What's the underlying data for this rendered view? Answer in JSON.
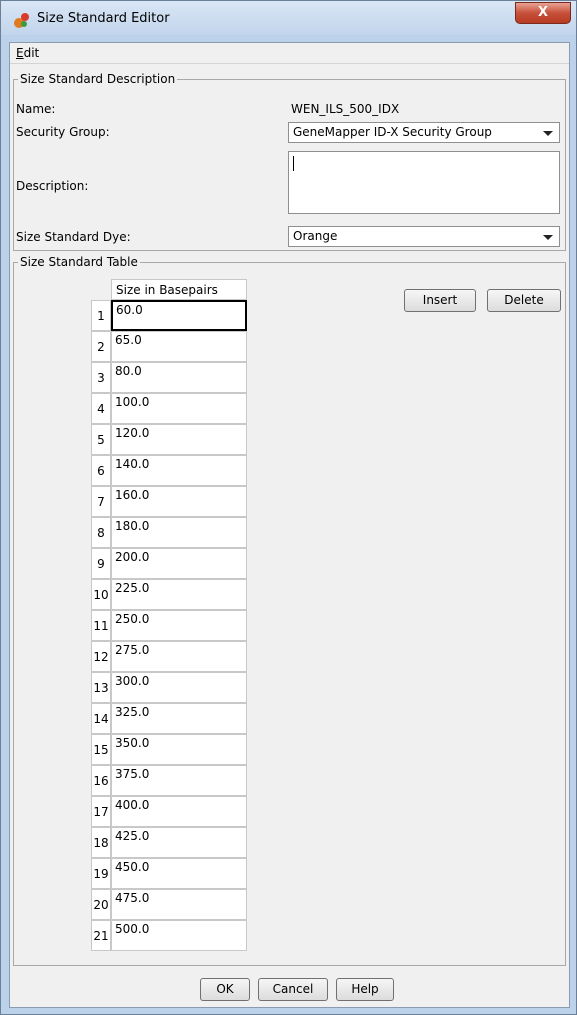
{
  "window": {
    "title": "Size Standard Editor",
    "close_glyph": "X"
  },
  "menu": {
    "edit_label": "Edit"
  },
  "description_group": {
    "title": "Size Standard Description",
    "name_label": "Name:",
    "name_value": "WEN_ILS_500_IDX",
    "security_label": "Security Group:",
    "security_value": "GeneMapper ID-X Security Group",
    "description_label": "Description:",
    "description_value": "",
    "dye_label": "Size Standard Dye:",
    "dye_value": "Orange"
  },
  "table_group": {
    "title": "Size Standard Table",
    "column_header": "Size in Basepairs",
    "selected_row": 1,
    "rows": [
      {
        "index": "1",
        "size": "60.0"
      },
      {
        "index": "2",
        "size": "65.0"
      },
      {
        "index": "3",
        "size": "80.0"
      },
      {
        "index": "4",
        "size": "100.0"
      },
      {
        "index": "5",
        "size": "120.0"
      },
      {
        "index": "6",
        "size": "140.0"
      },
      {
        "index": "7",
        "size": "160.0"
      },
      {
        "index": "8",
        "size": "180.0"
      },
      {
        "index": "9",
        "size": "200.0"
      },
      {
        "index": "10",
        "size": "225.0"
      },
      {
        "index": "11",
        "size": "250.0"
      },
      {
        "index": "12",
        "size": "275.0"
      },
      {
        "index": "13",
        "size": "300.0"
      },
      {
        "index": "14",
        "size": "325.0"
      },
      {
        "index": "15",
        "size": "350.0"
      },
      {
        "index": "16",
        "size": "375.0"
      },
      {
        "index": "17",
        "size": "400.0"
      },
      {
        "index": "18",
        "size": "425.0"
      },
      {
        "index": "19",
        "size": "450.0"
      },
      {
        "index": "20",
        "size": "475.0"
      },
      {
        "index": "21",
        "size": "500.0"
      }
    ],
    "insert_label": "Insert",
    "delete_label": "Delete"
  },
  "footer": {
    "ok_label": "OK",
    "cancel_label": "Cancel",
    "help_label": "Help"
  }
}
